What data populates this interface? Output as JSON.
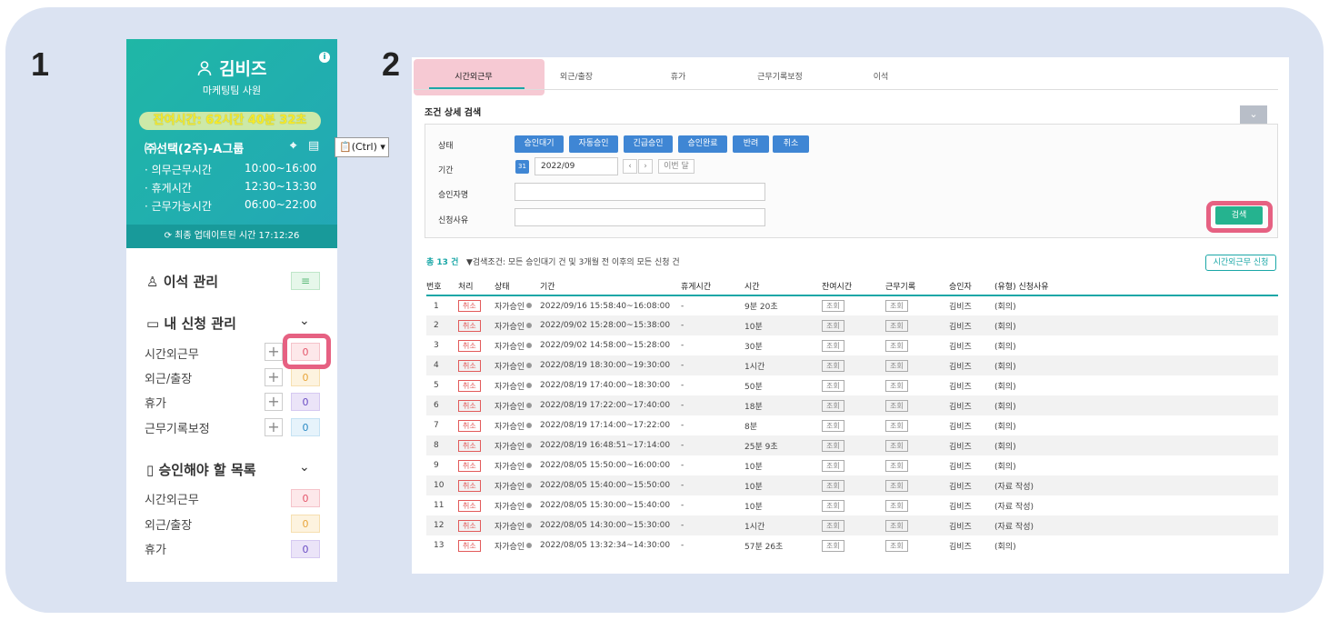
{
  "step1": "1",
  "step2": "2",
  "user": {
    "name": "김비즈",
    "role": "마케팅팀 사원",
    "remaining": "잔여시간: 62시간 40분 32초",
    "group": "㈜선택(2주)-A그룹",
    "schedule": [
      {
        "label": "· 의무근무시간",
        "time": "10:00~16:00"
      },
      {
        "label": "· 휴게시간",
        "time": "12:30~13:30"
      },
      {
        "label": "· 근무가능시간",
        "time": "06:00~22:00"
      }
    ],
    "updated": "최종 업데이트된 시간  17:12:26"
  },
  "menu": {
    "seat": "이석 관리",
    "my_requests": "내 신청 관리",
    "my_items": [
      {
        "label": "시간외근무",
        "count": "0"
      },
      {
        "label": "외근/출장",
        "count": "0"
      },
      {
        "label": "휴가",
        "count": "0"
      },
      {
        "label": "근무기록보정",
        "count": "0"
      }
    ],
    "approvals": "승인해야 할 목록",
    "approval_items": [
      {
        "label": "시간외근무",
        "count": "0"
      },
      {
        "label": "외근/출장",
        "count": "0"
      },
      {
        "label": "휴가",
        "count": "0"
      }
    ]
  },
  "ctrl_tip": "(Ctrl)",
  "tabs": [
    "시간외근무",
    "외근/출장",
    "휴가",
    "근무기록보정",
    "이석"
  ],
  "search": {
    "title": "조건 상세 검색",
    "status_label": "상태",
    "status_buttons": [
      "승인대기",
      "자동승인",
      "긴급승인",
      "승인완료",
      "반려",
      "취소"
    ],
    "period_label": "기간",
    "period_value": "2022/09",
    "prev_month": "이번 달",
    "approver_label": "승인자명",
    "reason_label": "신청사유",
    "search_button": "검색"
  },
  "summary": {
    "total": "총 13 건",
    "condition": "검색조건: 모든 승인대기 건 및 3개월 전 이후의 모든 신청 건",
    "apply_button": "시간외근무 신청"
  },
  "table": {
    "headers": [
      "번호",
      "처리",
      "상태",
      "기간",
      "휴게시간",
      "시간",
      "잔여시간",
      "근무기록",
      "승인자",
      "(유형) 신청사유"
    ],
    "cancel_tag": "취소",
    "view_tag": "조회",
    "rows": [
      {
        "no": "1",
        "status": "자가승인",
        "period": "2022/09/16 15:58:40~16:08:00",
        "break": "-",
        "time": "9분 20초",
        "approver": "김비즈",
        "reason": "(회의)"
      },
      {
        "no": "2",
        "status": "자가승인",
        "period": "2022/09/02 15:28:00~15:38:00",
        "break": "-",
        "time": "10분",
        "approver": "김비즈",
        "reason": "(회의)"
      },
      {
        "no": "3",
        "status": "자가승인",
        "period": "2022/09/02 14:58:00~15:28:00",
        "break": "-",
        "time": "30분",
        "approver": "김비즈",
        "reason": "(회의)"
      },
      {
        "no": "4",
        "status": "자가승인",
        "period": "2022/08/19 18:30:00~19:30:00",
        "break": "-",
        "time": "1시간",
        "approver": "김비즈",
        "reason": "(회의)"
      },
      {
        "no": "5",
        "status": "자가승인",
        "period": "2022/08/19 17:40:00~18:30:00",
        "break": "-",
        "time": "50분",
        "approver": "김비즈",
        "reason": "(회의)"
      },
      {
        "no": "6",
        "status": "자가승인",
        "period": "2022/08/19 17:22:00~17:40:00",
        "break": "-",
        "time": "18분",
        "approver": "김비즈",
        "reason": "(회의)"
      },
      {
        "no": "7",
        "status": "자가승인",
        "period": "2022/08/19 17:14:00~17:22:00",
        "break": "-",
        "time": "8분",
        "approver": "김비즈",
        "reason": "(회의)"
      },
      {
        "no": "8",
        "status": "자가승인",
        "period": "2022/08/19 16:48:51~17:14:00",
        "break": "-",
        "time": "25분 9초",
        "approver": "김비즈",
        "reason": "(회의)"
      },
      {
        "no": "9",
        "status": "자가승인",
        "period": "2022/08/05 15:50:00~16:00:00",
        "break": "-",
        "time": "10분",
        "approver": "김비즈",
        "reason": "(회의)"
      },
      {
        "no": "10",
        "status": "자가승인",
        "period": "2022/08/05 15:40:00~15:50:00",
        "break": "-",
        "time": "10분",
        "approver": "김비즈",
        "reason": "(자료 작성)"
      },
      {
        "no": "11",
        "status": "자가승인",
        "period": "2022/08/05 15:30:00~15:40:00",
        "break": "-",
        "time": "10분",
        "approver": "김비즈",
        "reason": "(자료 작성)"
      },
      {
        "no": "12",
        "status": "자가승인",
        "period": "2022/08/05 14:30:00~15:30:00",
        "break": "-",
        "time": "1시간",
        "approver": "김비즈",
        "reason": "(자료 작성)"
      },
      {
        "no": "13",
        "status": "자가승인",
        "period": "2022/08/05 13:32:34~14:30:00",
        "break": "-",
        "time": "57분 26초",
        "approver": "김비즈",
        "reason": "(회의)"
      }
    ]
  },
  "colors": {
    "accent": "#1aa7a7",
    "highlight": "#e66182",
    "button_blue": "#3f86d4",
    "search_green": "#25b38f"
  }
}
